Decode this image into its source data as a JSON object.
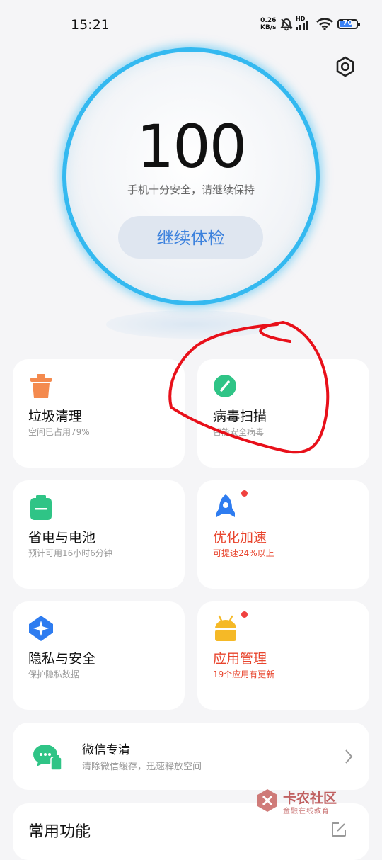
{
  "status_bar": {
    "time": "15:21",
    "net_speed_value": "0.26",
    "net_speed_unit": "KB/s",
    "hd_label": "HD",
    "battery_level": "70"
  },
  "score": {
    "value": "100",
    "message": "手机十分安全，请继续保持",
    "button_label": "继续体检"
  },
  "cards": [
    {
      "title": "垃圾清理",
      "subtitle": "空间已占用79%",
      "icon": "trash-icon",
      "color": "#f48a4e"
    },
    {
      "title": "病毒扫描",
      "subtitle": "智能安全病毒",
      "icon": "virus-scan-icon",
      "color": "#2fc486"
    },
    {
      "title": "省电与电池",
      "subtitle": "预计可用16小时6分钟",
      "icon": "battery-icon",
      "color": "#2fc486"
    },
    {
      "title": "优化加速",
      "subtitle": "可提速24%以上",
      "icon": "rocket-icon",
      "color": "#2e7cf0",
      "highlight": true
    },
    {
      "title": "隐私与安全",
      "subtitle": "保护隐私数据",
      "icon": "privacy-shield-icon",
      "color": "#2e7cf0"
    },
    {
      "title": "应用管理",
      "subtitle": "19个应用有更新",
      "icon": "android-icon",
      "color": "#f5b927",
      "highlight": true
    }
  ],
  "wechat": {
    "title": "微信专清",
    "subtitle": "清除微信缓存，迅速释放空间",
    "icon": "wechat-clean-icon"
  },
  "common": {
    "title": "常用功能",
    "edit_icon": "edit-icon"
  },
  "watermark": {
    "main": "卡农社区",
    "sub": "金融在线教育"
  },
  "colors": {
    "accent": "#34b9f0",
    "button_text": "#3d82dd",
    "alert_red": "#e8452e",
    "annotation_red": "#e8101a"
  }
}
